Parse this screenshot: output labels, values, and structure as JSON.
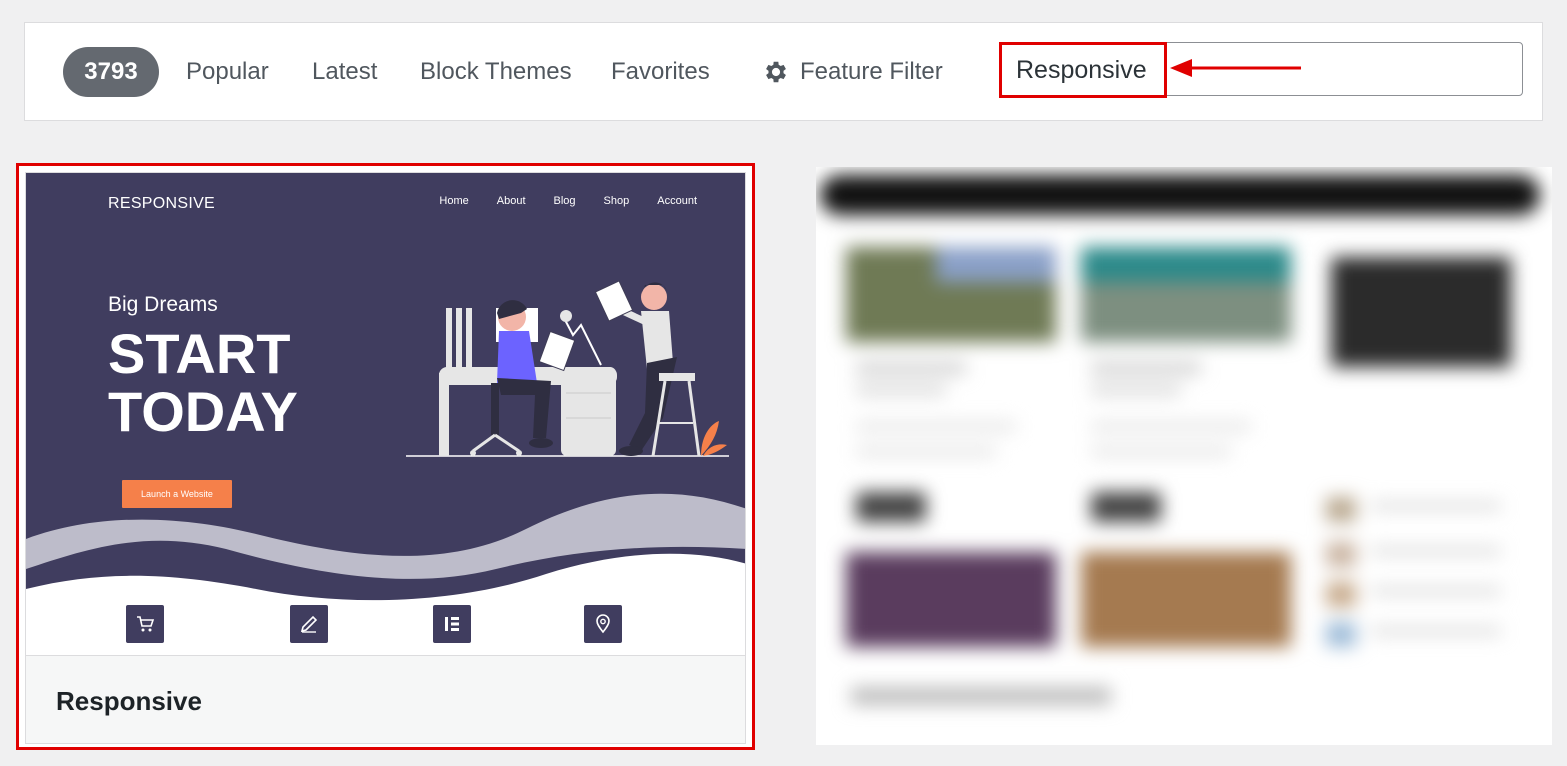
{
  "filter_bar": {
    "theme_count": "3793",
    "links": {
      "popular": "Popular",
      "latest": "Latest",
      "block_themes": "Block Themes",
      "favorites": "Favorites",
      "feature_filter": "Feature Filter"
    },
    "search": {
      "value": "Responsive"
    }
  },
  "annotation": {
    "color": "#e00000"
  },
  "theme_card": {
    "name": "Responsive",
    "preview": {
      "logo": "RESPONSIVE",
      "nav": [
        "Home",
        "About",
        "Blog",
        "Shop",
        "Account"
      ],
      "kicker": "Big Dreams",
      "headline": "START TODAY",
      "cta": "Launch a Website",
      "colors": {
        "background": "#403d5f",
        "accent": "#f5804a",
        "wave": "#bdbcca"
      }
    }
  },
  "icons": [
    "gear-icon",
    "arrow-left-icon",
    "cart-icon",
    "pencil-icon",
    "elementor-icon",
    "location-pin-icon"
  ]
}
